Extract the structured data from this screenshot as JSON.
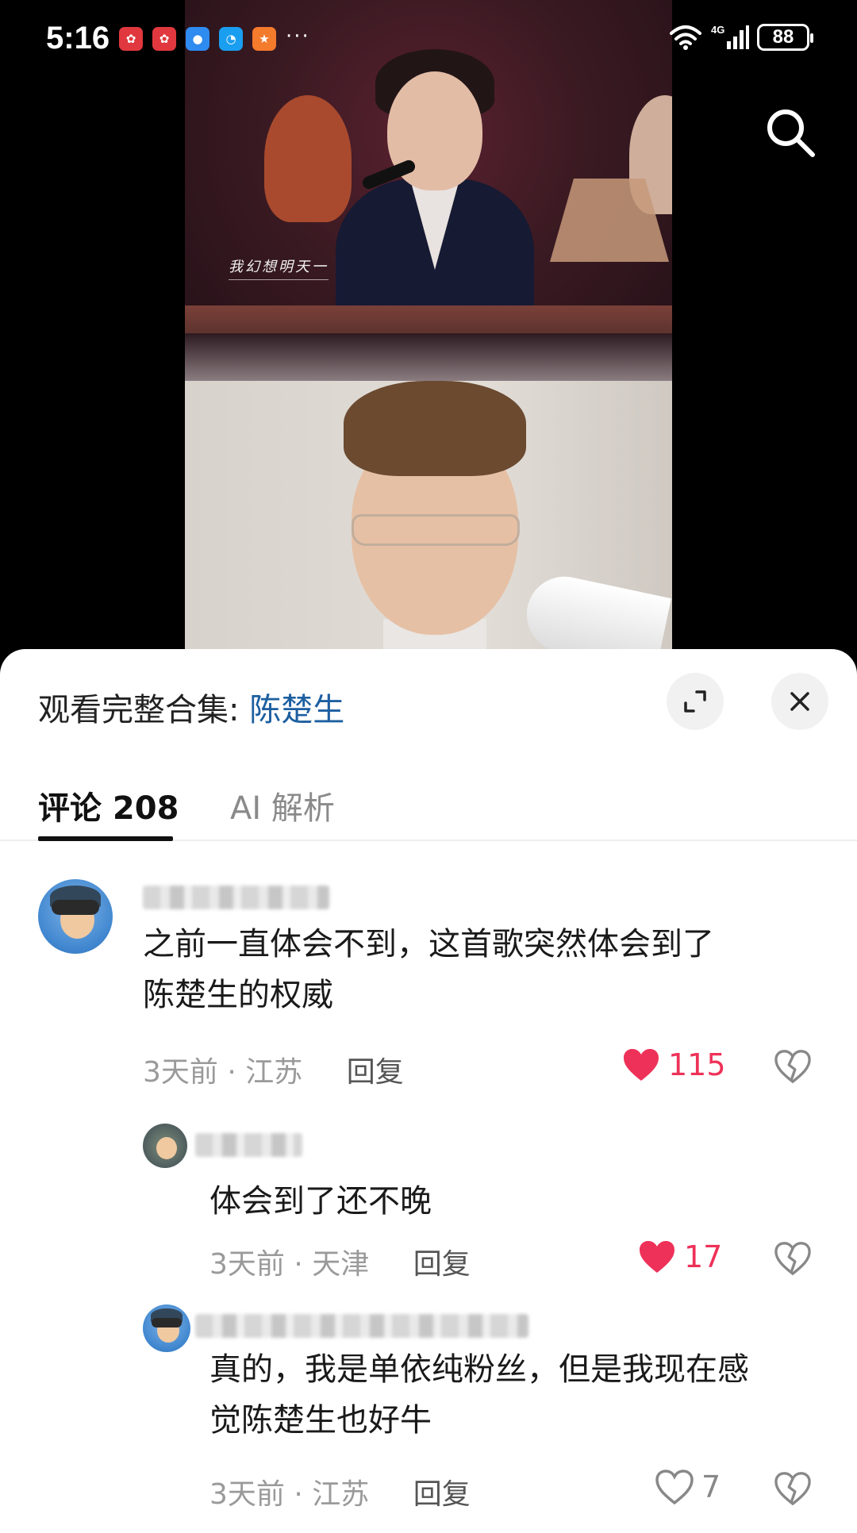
{
  "status_bar": {
    "time": "5:16",
    "network": "4G",
    "battery": "88",
    "notification_icons": [
      "huawei-app-icon",
      "huawei-app-icon",
      "message-icon",
      "browser-icon",
      "fitness-app-icon"
    ],
    "more": "···"
  },
  "video": {
    "lyric_caption": "我幻想明天一"
  },
  "sheet": {
    "collection_prefix": "观看完整合集: ",
    "collection_link": "陈楚生"
  },
  "tabs": {
    "comments": "评论 208",
    "ai": "AI 解析"
  },
  "comments": [
    {
      "text_line1": "之前一直体会不到，这首歌突然体会到了",
      "text_line2": "陈楚生的权威",
      "time": "3天前",
      "location": "江苏",
      "reply_label": "回复",
      "likes": "115",
      "liked": true
    },
    {
      "text": "体会到了还不晚",
      "time": "3天前",
      "location": "天津",
      "reply_label": "回复",
      "likes": "17",
      "liked": true
    },
    {
      "text_line1": "真的，我是单依纯粉丝，但是我现在感",
      "text_line2": "觉陈楚生也好牛",
      "time": "3天前",
      "location": "江苏",
      "reply_label": "回复",
      "likes": "7",
      "liked": false
    }
  ],
  "colors": {
    "accent_link": "#1d5fa0",
    "like_red": "#ee3158"
  }
}
